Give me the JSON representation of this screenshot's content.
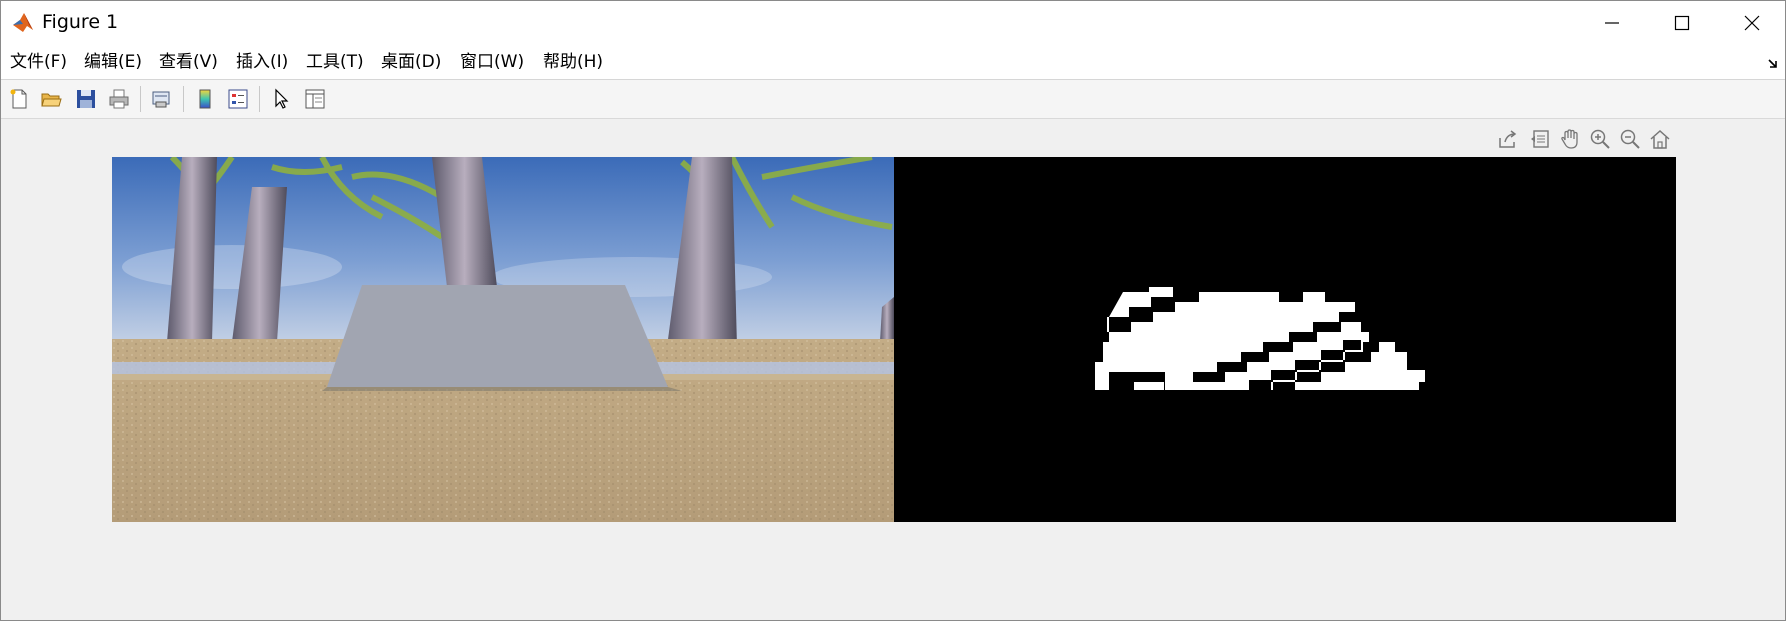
{
  "window": {
    "title": "Figure 1",
    "controls": [
      "minimize-icon",
      "maximize-icon",
      "close-icon"
    ]
  },
  "menu": {
    "items": [
      "文件(F)",
      "编辑(E)",
      "查看(V)",
      "插入(I)",
      "工具(T)",
      "桌面(D)",
      "窗口(W)",
      "帮助(H)"
    ]
  },
  "toolbar": {
    "icons": [
      "new-figure-icon",
      "open-file-icon",
      "save-icon",
      "print-icon",
      "link-plot-icon",
      "insert-colorbar-icon",
      "insert-legend-icon",
      "edit-plot-icon",
      "property-inspector-icon"
    ]
  },
  "axes_toolbar": {
    "icons": [
      "export-icon",
      "brush-icon",
      "pan-icon",
      "zoom-in-icon",
      "zoom-out-icon",
      "home-icon"
    ]
  },
  "colors": {
    "sky": "#5c86c4",
    "sand": "#bda982",
    "box": "#a1a5b1",
    "mask_background": "#000000",
    "mask_foreground": "#ffffff"
  }
}
